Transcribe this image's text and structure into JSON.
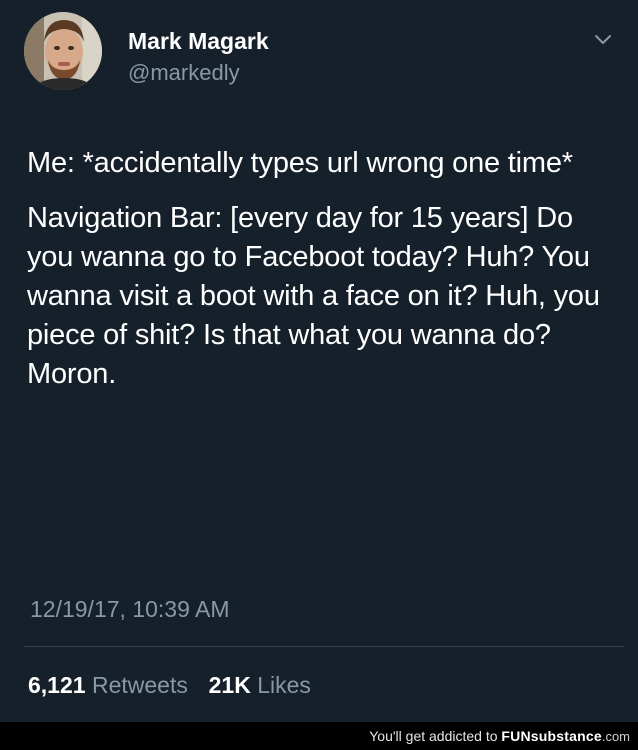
{
  "tweet": {
    "display_name": "Mark Magark",
    "handle": "@markedly",
    "paragraph_1": "Me: *accidentally types url wrong one time*",
    "paragraph_2": "Navigation Bar: [every day for 15 years] Do you wanna go to Faceboot today? Huh? You wanna visit a boot with a face on it? Huh, you piece of shit? Is that what you wanna do? Moron.",
    "timestamp": "12/19/17, 10:39 AM",
    "retweets_count": "6,121",
    "retweets_label": "Retweets",
    "likes_count": "21K",
    "likes_label": "Likes"
  },
  "watermark": {
    "prefix": "You'll get addicted to",
    "brand": "FUNsubstance",
    "suffix": ".com"
  },
  "icons": {
    "menu": "chevron-down-icon",
    "avatar": "avatar"
  },
  "colors": {
    "background": "#15202b",
    "text_primary": "#ffffff",
    "text_secondary": "#8899a6",
    "divider": "#38444d",
    "watermark_bar": "#000000"
  }
}
